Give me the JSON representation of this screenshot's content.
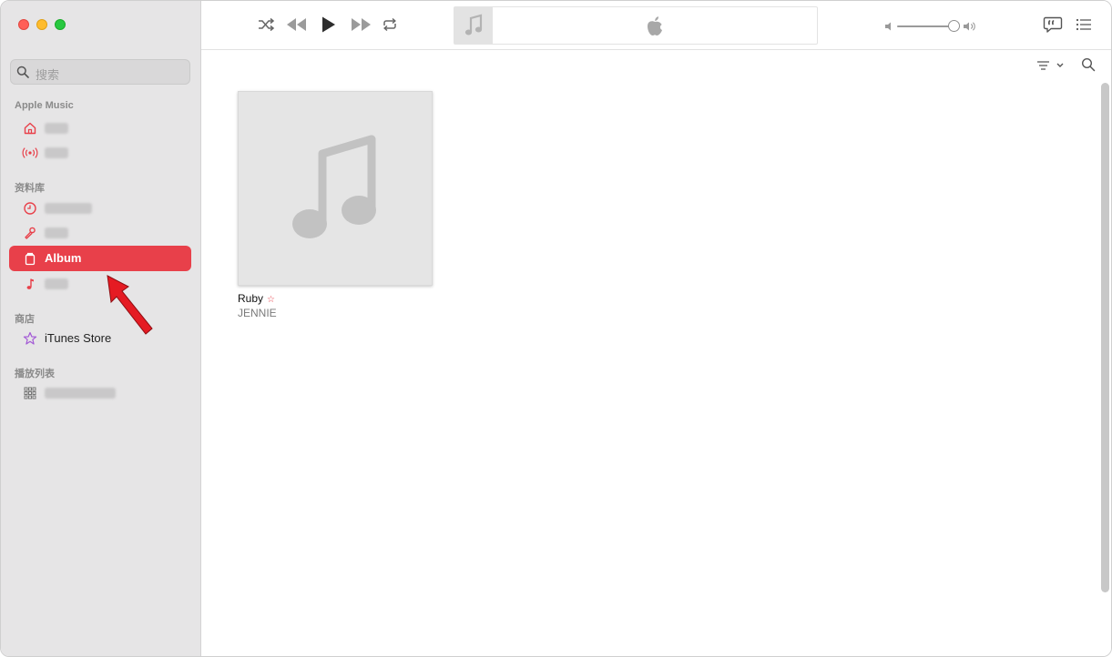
{
  "search": {
    "placeholder": "搜索"
  },
  "sidebar": {
    "sections": {
      "apple_music": "Apple Music",
      "library": "资料库",
      "store": "商店",
      "playlists": "播放列表"
    },
    "items": [
      {
        "icon": "home-icon",
        "label": ""
      },
      {
        "icon": "radio-icon",
        "label": ""
      },
      {
        "icon": "clock-icon",
        "label": ""
      },
      {
        "icon": "microphone-icon",
        "label": ""
      },
      {
        "icon": "album-icon",
        "label": "Album",
        "active": true
      },
      {
        "icon": "music-note-icon",
        "label": ""
      },
      {
        "icon": "star-icon",
        "label": "iTunes Store"
      },
      {
        "icon": "grid-icon",
        "label": ""
      }
    ]
  },
  "toolbar": {
    "controls": [
      "shuffle-icon",
      "rewind-icon",
      "play-icon",
      "fast-forward-icon",
      "repeat-icon"
    ],
    "volume_level": 0.85
  },
  "content": {
    "albums": [
      {
        "title": "Ruby",
        "artist": "JENNIE",
        "favorite_marker": "☆"
      }
    ]
  },
  "colors": {
    "accent": "#e8404a",
    "sidebar": "#e6e5e6"
  }
}
